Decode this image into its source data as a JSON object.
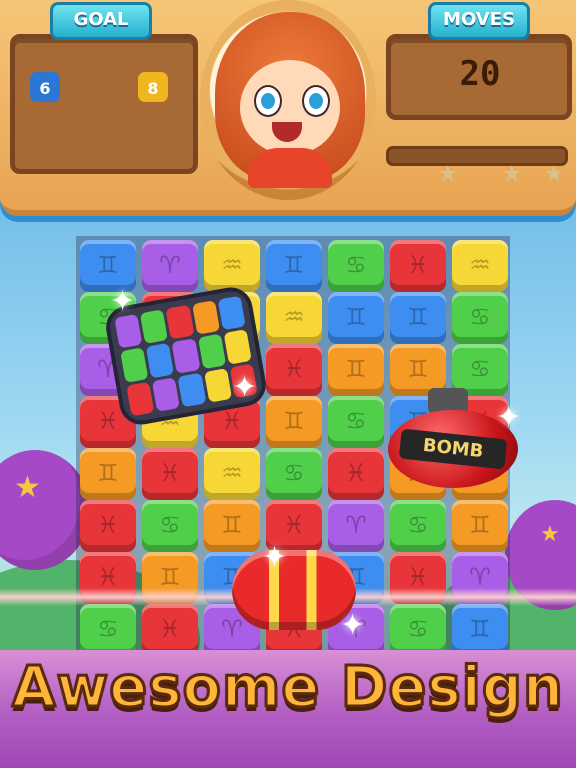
{
  "header": {
    "goal_label": "GOAL",
    "moves_label": "MOVES",
    "moves_value": "20",
    "goals": [
      {
        "count": "6",
        "color": "#2c76d6",
        "icon": "gemini-tile-icon"
      },
      {
        "count": "8",
        "color": "#f1b51e",
        "icon": "aquarius-tile-icon"
      }
    ],
    "progress": 0.0
  },
  "board": {
    "rows": [
      [
        "blue",
        "purple",
        "yellow",
        "blue",
        "green",
        "red",
        "yellow"
      ],
      [
        "green",
        "red",
        "yellow",
        "yellow",
        "blue",
        "blue",
        "green"
      ],
      [
        "purple",
        "purple",
        "red",
        "red",
        "orange",
        "orange",
        "green"
      ],
      [
        "red",
        "yellow",
        "red",
        "orange",
        "green",
        "blue",
        "red"
      ],
      [
        "orange",
        "red",
        "yellow",
        "green",
        "red",
        "orange",
        "orange"
      ],
      [
        "red",
        "green",
        "orange",
        "red",
        "purple",
        "green",
        "orange"
      ],
      [
        "red",
        "orange",
        "blue",
        "red",
        "blue",
        "red",
        "purple"
      ],
      [
        "green",
        "red",
        "purple",
        "red",
        "purple",
        "green",
        "blue"
      ]
    ],
    "colors": {
      "blue": "#3d8ef0",
      "purple": "#a85ee6",
      "yellow": "#f7d735",
      "green": "#4fcf4a",
      "red": "#e8353a",
      "orange": "#f59a24"
    }
  },
  "specials": {
    "bomb_label": "BOMB"
  },
  "banner": {
    "title": "Awesome Design"
  }
}
